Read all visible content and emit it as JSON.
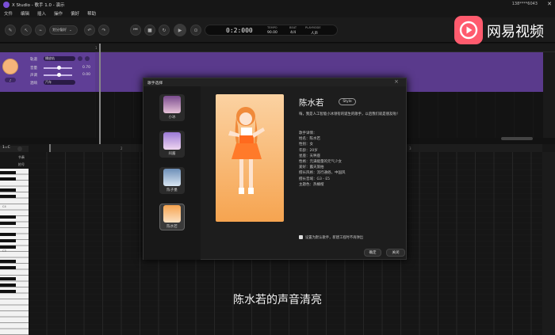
{
  "window": {
    "title": "X Studio - 歌手 1.0 - 演示",
    "user": "138****6043"
  },
  "menu": [
    "文件",
    "编辑",
    "插入",
    "操作",
    "偏好",
    "帮助"
  ],
  "toolbar": {
    "mode_label": "划分偏好",
    "time": "0:2:000",
    "tempo_label": "TEMPO",
    "tempo": "90.00",
    "beat_label": "BEAT",
    "beat": "4/4",
    "playmode_label": "PLAYMODE",
    "playmode": "人声"
  },
  "track": {
    "rows": [
      {
        "label": "轨道",
        "value": "播放轨"
      },
      {
        "label": "音量",
        "value": "0.70"
      },
      {
        "label": "声调",
        "value": "0.00"
      },
      {
        "label": "混响",
        "value": "汽车"
      }
    ]
  },
  "editor": {
    "key_label": "1=C",
    "tempo_label": "节奏",
    "tempo": "90.00",
    "beat_label": "拍号",
    "beat": "4/4",
    "note_c4": "C4",
    "note_c3": "C3",
    "ruler": [
      "1",
      "2",
      "3"
    ]
  },
  "dialog": {
    "title": "歌手选择",
    "singers": [
      {
        "name": "小冰"
      },
      {
        "name": "闷酱"
      },
      {
        "name": "陈子墨"
      },
      {
        "name": "陈水若"
      }
    ],
    "selected": {
      "name": "陈水若",
      "badge": "Style",
      "intro": "嗨，我是人工智能小冰领衔的诞生的歌手，以后我们就是朋友啦！",
      "details_title": "歌手详情：",
      "details": [
        "姓名：陈水若",
        "性别：女",
        "年龄：20岁",
        "星座：天秤座",
        "性格：元满能量的元气少女",
        "爱好：露天旅拍",
        "擅长风格：流行通俗，中国风",
        "擅长音域：G3 - E5",
        "主题色：热橘橙"
      ]
    },
    "checkbox_label": "设置为默认歌手，新建工程时不再弹出",
    "confirm_label": "确定",
    "close_label": "关闭"
  },
  "caption": "陈水若的声音清亮",
  "watermark": "网易视频",
  "colors": {
    "track_purple": "#5f3e96",
    "card_orange": "#f6a450",
    "accent": "#ff5b6e"
  }
}
